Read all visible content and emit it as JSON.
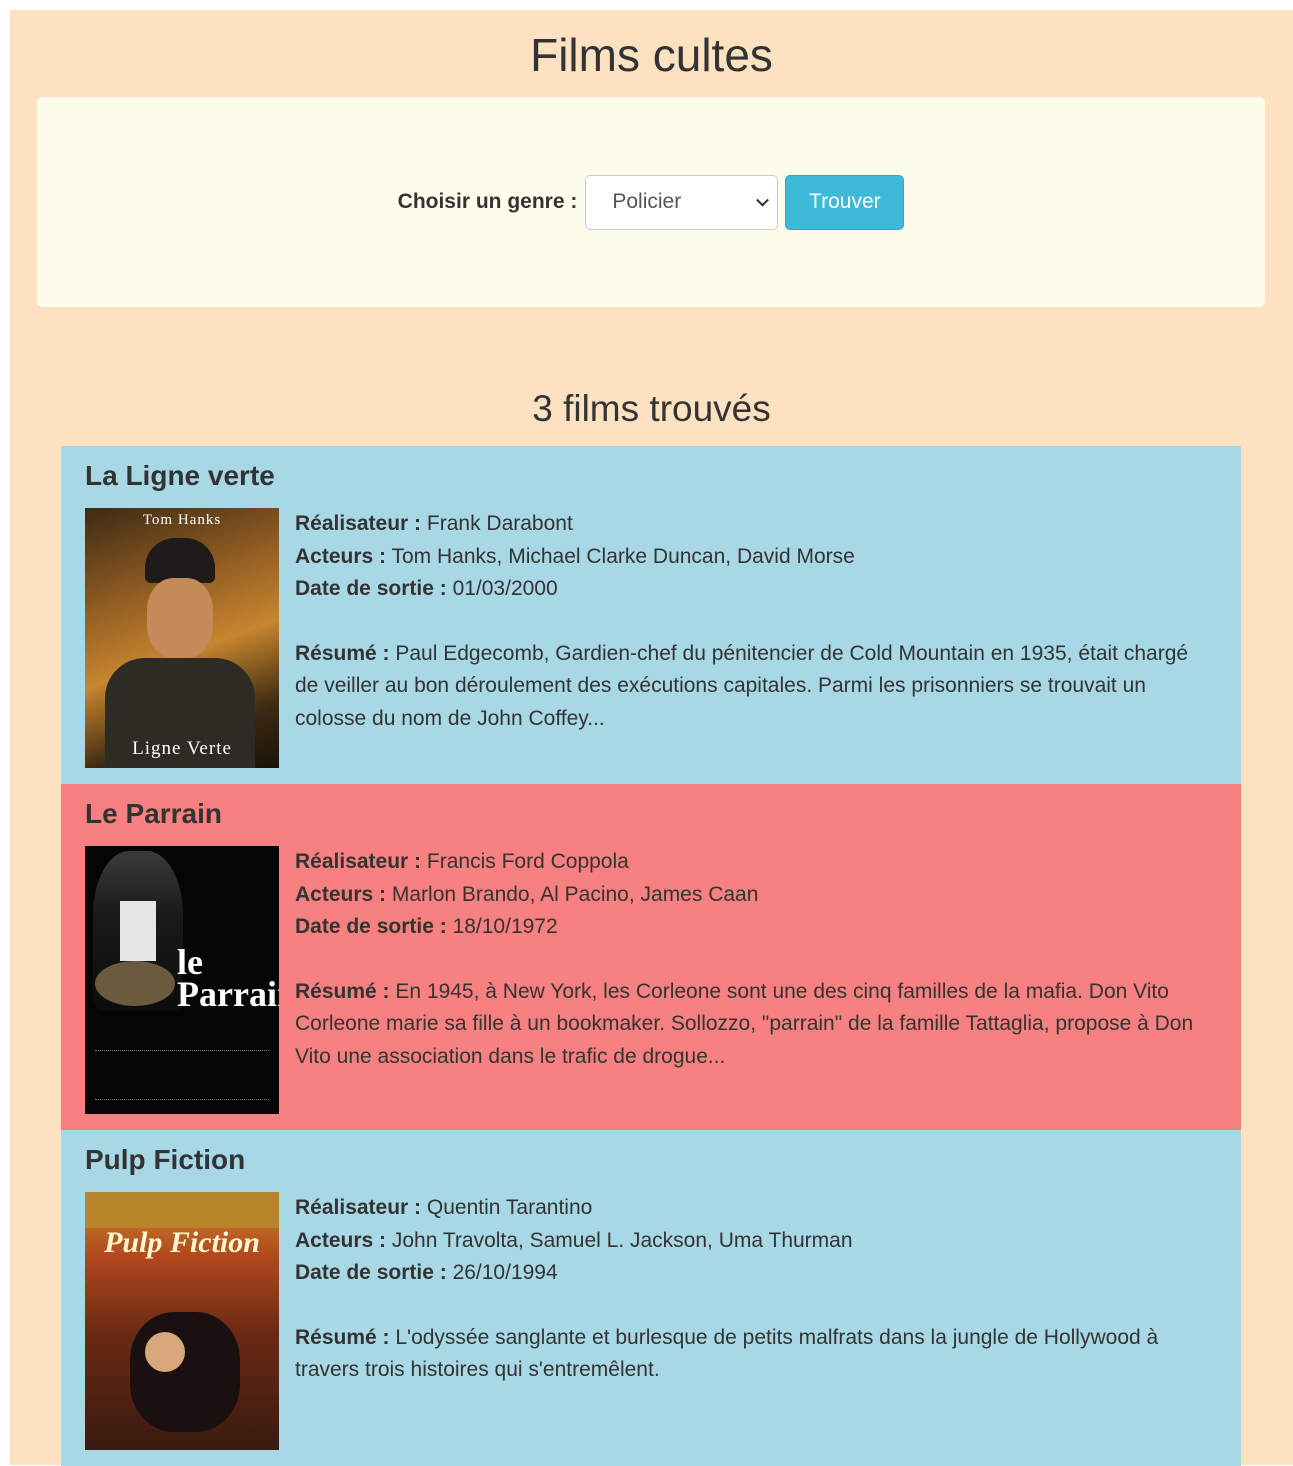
{
  "header": {
    "title": "Films cultes"
  },
  "search": {
    "genre_label": "Choisir un genre :",
    "genre_selected": "Policier",
    "submit_label": "Trouver"
  },
  "results": {
    "count_text": "3 films trouvés",
    "labels": {
      "director": "Réalisateur :",
      "actors": "Acteurs :",
      "release": "Date de sortie :",
      "summary": "Résumé :"
    },
    "movies": [
      {
        "title": "La Ligne verte",
        "director": "Frank Darabont",
        "actors": "Tom Hanks, Michael Clarke Duncan, David Morse",
        "release": "01/03/2000",
        "summary": "Paul Edgecomb, Gardien-chef du pénitencier de Cold Mountain en 1935, était chargé de veiller au bon déroulement des exécutions capitales. Parmi les prisonniers se trouvait un colosse du nom de John Coffey...",
        "poster_text_top": "Tom Hanks",
        "poster_text_bottom": "Ligne Verte",
        "bg": "#a8d8e6"
      },
      {
        "title": "Le Parrain",
        "director": "Francis Ford Coppola",
        "actors": "Marlon Brando, Al Pacino, James Caan",
        "release": "18/10/1972",
        "summary": "En 1945, à New York, les Corleone sont une des cinq familles de la mafia. Don Vito Corleone marie sa fille à un bookmaker. Sollozzo, \"parrain\" de la famille Tattaglia, propose à Don Vito une association dans le trafic de drogue...",
        "poster_text": "le Parrain",
        "bg": "#f78080"
      },
      {
        "title": "Pulp Fiction",
        "director": "Quentin Tarantino",
        "actors": "John Travolta, Samuel L. Jackson, Uma Thurman",
        "release": "26/10/1994",
        "summary": "L'odyssée sanglante et burlesque de petits malfrats dans la jungle de Hollywood à travers trois histoires qui s'entremêlent.",
        "poster_text": "Pulp Fiction",
        "bg": "#a8d8e6"
      }
    ]
  }
}
